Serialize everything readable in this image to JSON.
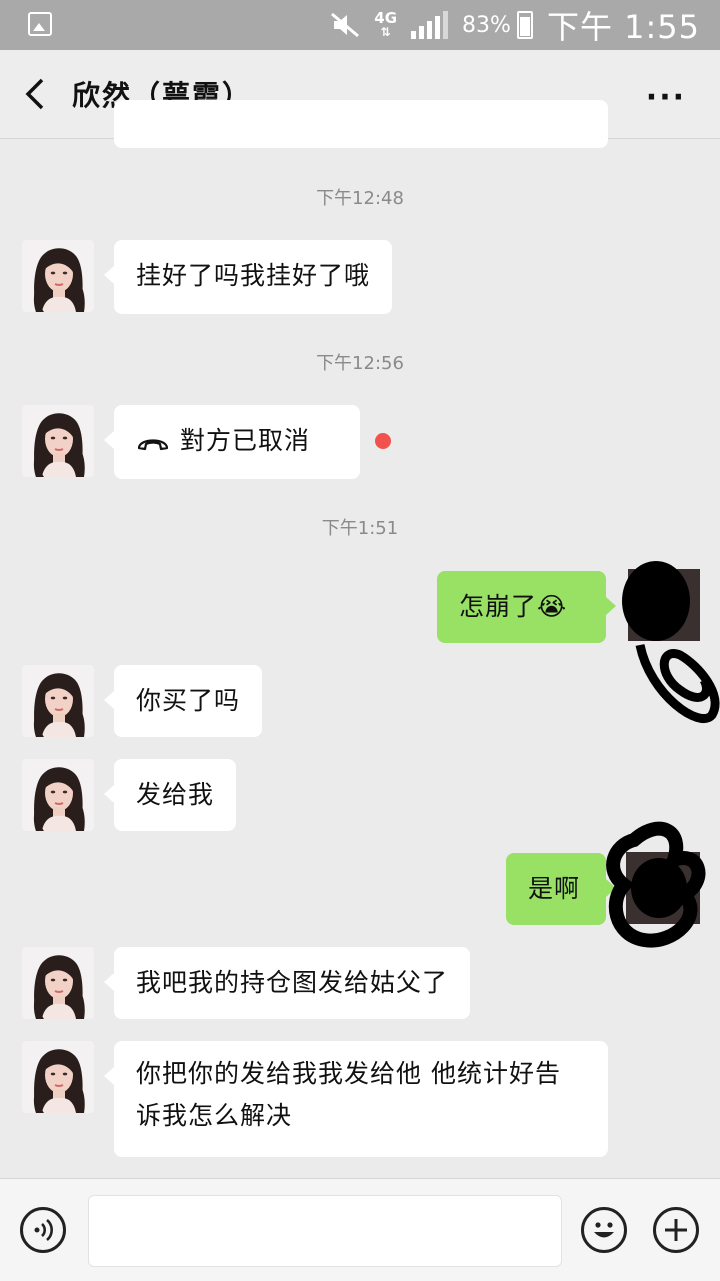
{
  "status_bar": {
    "network": "4G",
    "battery": "83%",
    "time": "下午 1:55",
    "icons": [
      "gallery-icon",
      "mute-icon",
      "signal-icon",
      "battery-icon"
    ]
  },
  "header": {
    "title": "欣然（萼霞）",
    "more_label": "···"
  },
  "messages": {
    "ts1": "下午12:48",
    "m1": "挂好了吗我挂好了哦",
    "ts2": "下午12:56",
    "m2": "對方已取消",
    "ts3": "下午1:51",
    "m3": "怎崩了",
    "m3_emoji": "😭",
    "m4": "你买了吗",
    "m5": "发给我",
    "m6": "是啊",
    "m7": "我吧我的持仓图发给姑父了",
    "m8": "你把你的发给我我发给他 他统计好告诉我怎么解决"
  },
  "input_bar": {
    "placeholder": "",
    "icons": [
      "voice-icon",
      "emoji-icon",
      "plus-icon"
    ]
  },
  "colors": {
    "background": "#ebebeb",
    "sent_bubble": "#98e165",
    "received_bubble": "#ffffff",
    "unread_dot": "#f2524d",
    "status_bar": "#a9a9a9"
  }
}
